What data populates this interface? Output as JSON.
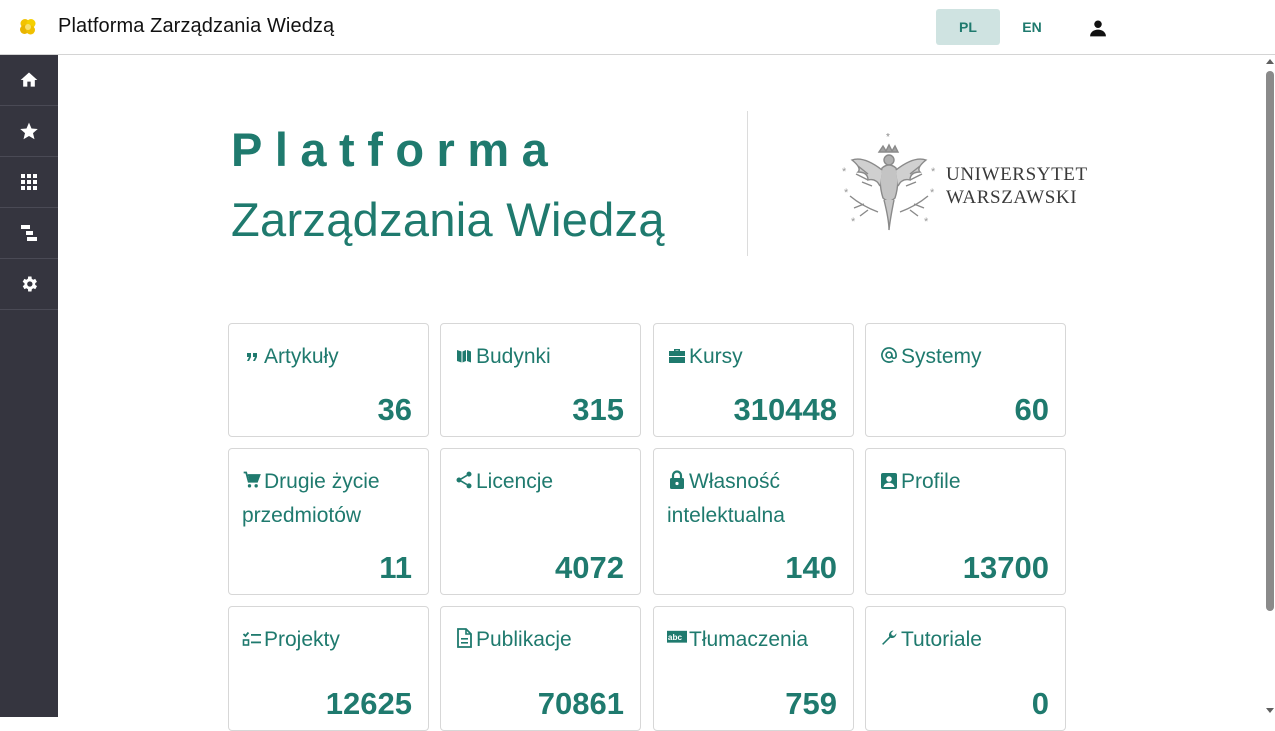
{
  "header": {
    "app_title": "Platforma Zarządzania Wiedzą",
    "lang_pl": "PL",
    "lang_en": "EN",
    "logo_icon": "flower-logo-icon",
    "user_icon": "person-icon"
  },
  "sidebar": {
    "items": [
      {
        "icon": "home-icon"
      },
      {
        "icon": "star-icon"
      },
      {
        "icon": "grid-icon"
      },
      {
        "icon": "hierarchy-icon"
      },
      {
        "icon": "gear-icon"
      }
    ]
  },
  "hero": {
    "title_line1": "Platforma",
    "title_line2": "Zarządzania Wiedzą",
    "uw_line1": "UNIWERSYTET",
    "uw_line2": "WARSZAWSKI"
  },
  "cards": [
    {
      "label": "Artykuły",
      "value": "36",
      "icon": "quote-icon"
    },
    {
      "label": "Budynki",
      "value": "315",
      "icon": "map-icon"
    },
    {
      "label": "Kursy",
      "value": "310448",
      "icon": "briefcase-icon"
    },
    {
      "label": "Systemy",
      "value": "60",
      "icon": "at-icon"
    },
    {
      "label": "Drugie życie przedmiotów",
      "value": "11",
      "icon": "cart-icon"
    },
    {
      "label": "Licencje",
      "value": "4072",
      "icon": "share-icon"
    },
    {
      "label": "Własność intelektualna",
      "value": "140",
      "icon": "lock-icon"
    },
    {
      "label": "Profile",
      "value": "13700",
      "icon": "contact-icon"
    },
    {
      "label": "Projekty",
      "value": "12625",
      "icon": "checklist-icon"
    },
    {
      "label": "Publikacje",
      "value": "70861",
      "icon": "document-icon"
    },
    {
      "label": "Tłumaczenia",
      "value": "759",
      "icon": "spellcheck-icon"
    },
    {
      "label": "Tutoriale",
      "value": "0",
      "icon": "wrench-icon"
    }
  ],
  "colors": {
    "accent": "#1f7a6e",
    "sidebar": "#35353f",
    "lang_active_bg": "#cfe3e1"
  }
}
